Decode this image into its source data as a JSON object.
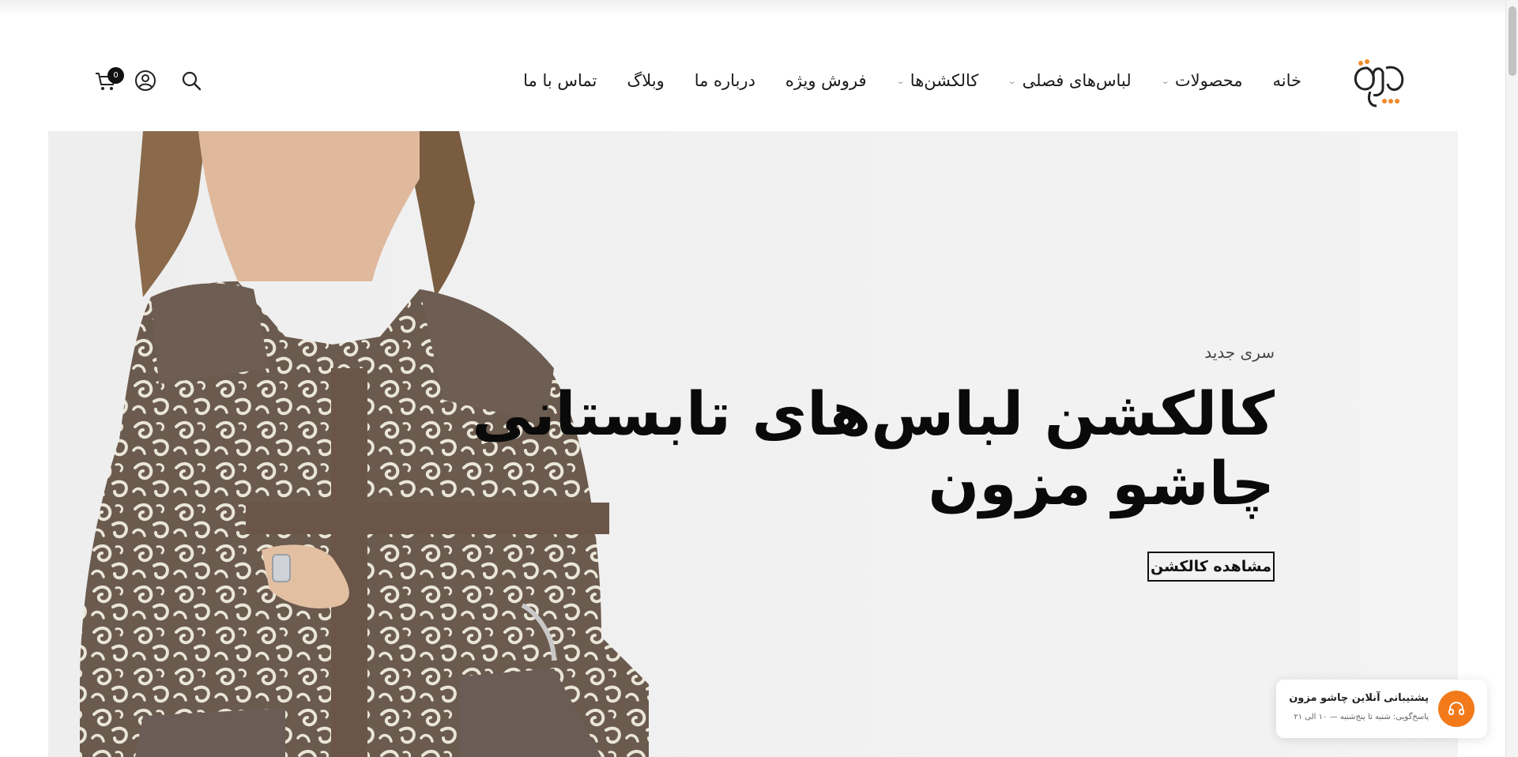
{
  "nav": {
    "items": [
      {
        "label": "خانه",
        "has_dropdown": false
      },
      {
        "label": "محصولات",
        "has_dropdown": true
      },
      {
        "label": "لباس‌های فصلی",
        "has_dropdown": true
      },
      {
        "label": "کالکشن‌ها",
        "has_dropdown": true
      },
      {
        "label": "فروش ویژه",
        "has_dropdown": false
      },
      {
        "label": "درباره ما",
        "has_dropdown": false
      },
      {
        "label": "وبلاگ",
        "has_dropdown": false
      },
      {
        "label": "تماس با ما",
        "has_dropdown": false
      }
    ],
    "dropdown_glyph": "⌄"
  },
  "header": {
    "icons": [
      "search-icon",
      "user-account-icon",
      "cart-icon"
    ],
    "cart_count": "0"
  },
  "hero": {
    "kicker": "سری جدید",
    "headline_line1": "کالکشن لباس‌های تابستانی",
    "headline_line2": "چاشو مزون",
    "cta_label": "مشاهده کالکشن"
  },
  "support_widget": {
    "title": "پشتیبانی آنلاین چاشو مزون",
    "subtitle": "پاسخ‌گویی: شنبه تا پنج‌شنبه — ۱۰ الی ۲۱",
    "icon": "headset-icon",
    "accent_color": "#f27a1a"
  },
  "colors": {
    "logo_accent": "#f28a2a",
    "text_dark": "#111111"
  }
}
